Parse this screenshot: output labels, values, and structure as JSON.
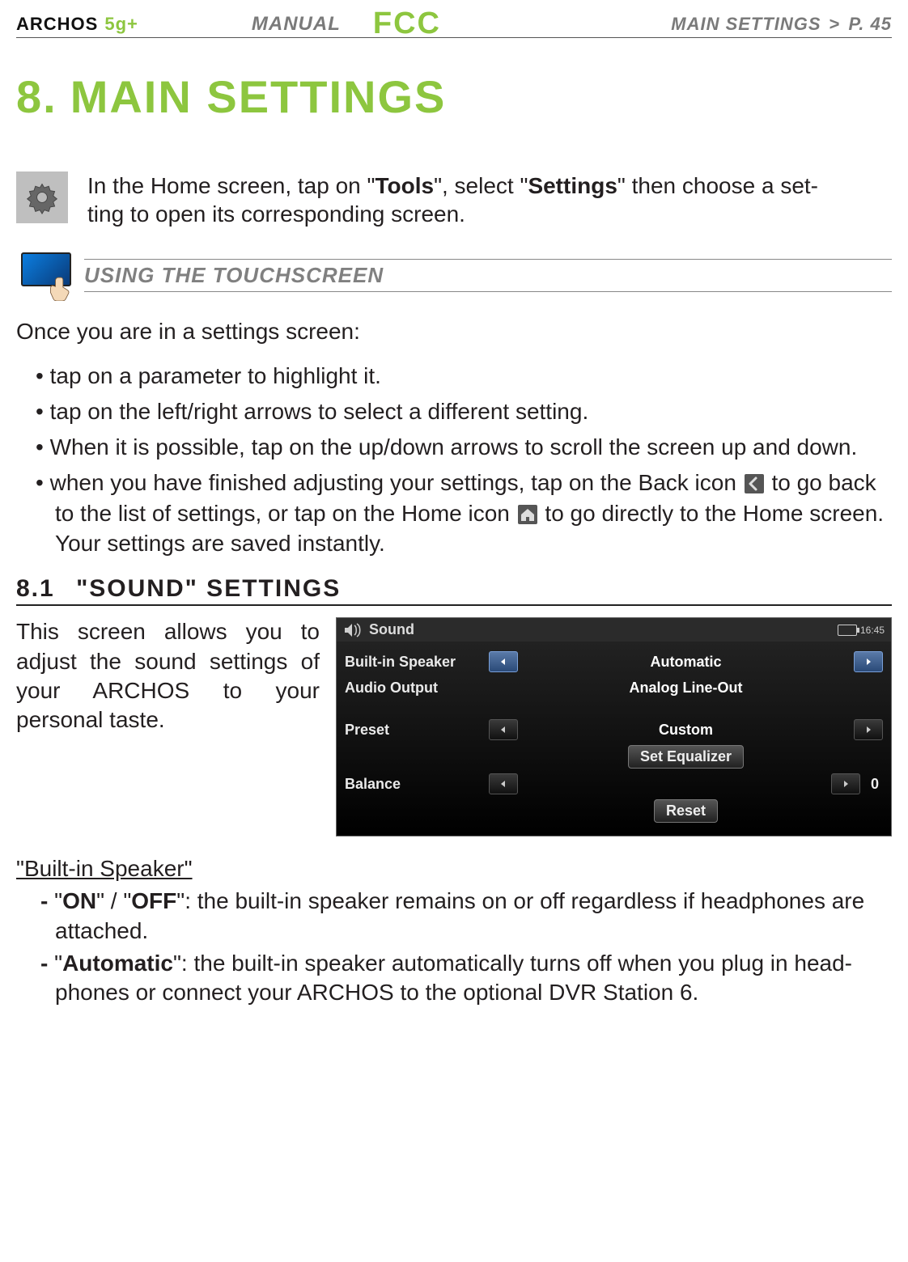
{
  "header": {
    "brand": "ARCHOS",
    "model": "5g+",
    "manual": "MANUAL",
    "fcc": "FCC",
    "breadcrumb_title": "MAIN SETTINGS",
    "breadcrumb_sep": ">",
    "breadcrumb_page": "P. 45"
  },
  "chapter": {
    "number": "8.",
    "title": "MAIN SETTINGS"
  },
  "intro": {
    "pre": "In the Home screen, tap on \"",
    "tools": "Tools",
    "mid": "\", select \"",
    "settings": "Settings",
    "post": "\" then choose a set-",
    "line2": "ting to open its corresponding screen."
  },
  "touch_heading": "USING THE TOUCHSCREEN",
  "settings_lead": "Once you are in a settings screen:",
  "bullets": {
    "b1": "tap on a parameter to highlight it.",
    "b2": "tap on the left/right arrows to select a different setting.",
    "b3": "When it is possible, tap on the up/down arrows to scroll the screen up and down.",
    "b4_a": "when you have finished adjusting your settings, tap on the Back icon ",
    "b4_b": " to go back to the list of settings, or tap on the Home icon ",
    "b4_c": " to go directly to the Home screen. Your settings are saved instantly."
  },
  "section": {
    "num": "8.1",
    "title": "\"SOUND\" SETTINGS"
  },
  "sound_intro": "This screen allows you to adjust the sound settings of your ARCHOS to your personal taste.",
  "device": {
    "title": "Sound",
    "time": "16:45",
    "rows": {
      "speaker_label": "Built-in Speaker",
      "speaker_value": "Automatic",
      "audio_label": "Audio Output",
      "audio_value": "Analog Line-Out",
      "preset_label": "Preset",
      "preset_value": "Custom",
      "eq_button": "Set Equalizer",
      "balance_label": "Balance",
      "balance_value": "0",
      "reset_button": "Reset"
    }
  },
  "builtin_heading": "\"Built-in Speaker\"",
  "builtin_items": {
    "on": "ON",
    "off": "OFF",
    "onoff_desc": "\": the built-in speaker remains on or off regardless if headphones are attached.",
    "auto": "Automatic",
    "auto_desc": "\": the built-in speaker automatically turns off when you plug in head­phones or connect your ARCHOS to the optional DVR Station 6."
  }
}
